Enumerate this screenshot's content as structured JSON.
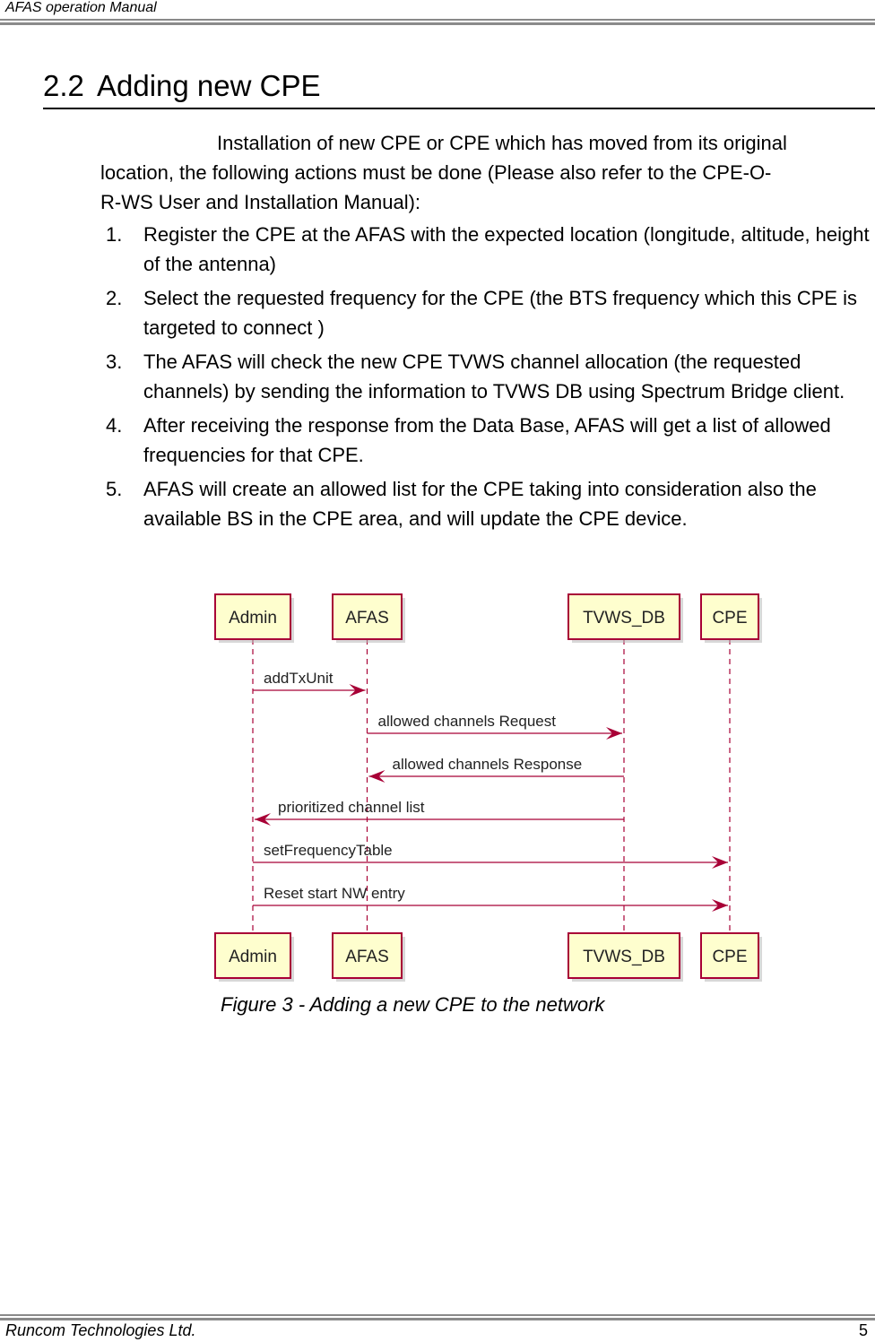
{
  "header": {
    "title": "AFAS operation Manual"
  },
  "section": {
    "number": "2.2",
    "title": "Adding new CPE"
  },
  "intro": {
    "line1": "Installation of new CPE or CPE which has moved from its original",
    "line2": "location, the following actions must be done (Please also refer to the CPE-O-",
    "line3": "R-WS User and Installation Manual):"
  },
  "steps": [
    {
      "num": "1.",
      "text": "Register the CPE at the AFAS with the expected location (longitude, altitude, height of the antenna)"
    },
    {
      "num": "2.",
      "text": "Select the requested frequency for the CPE (the BTS frequency which this CPE is targeted to connect )"
    },
    {
      "num": "3.",
      "text": "The AFAS will check the new CPE TVWS channel allocation (the requested channels) by sending the information to TVWS DB using Spectrum Bridge client."
    },
    {
      "num": "4.",
      "text": "After receiving the response from the Data Base, AFAS will get a list of allowed frequencies for that CPE."
    },
    {
      "num": "5.",
      "text": "AFAS will create an allowed list for the CPE taking into consideration also the available BS in the CPE area, and will update the CPE device."
    }
  ],
  "diagram": {
    "colors": {
      "box_fill": "#FEFECE",
      "box_border": "#A80036",
      "line": "#A80036",
      "text": "#222222"
    },
    "participants": [
      {
        "id": "admin",
        "label": "Admin"
      },
      {
        "id": "afas",
        "label": "AFAS"
      },
      {
        "id": "tvws",
        "label": "TVWS_DB"
      },
      {
        "id": "cpe",
        "label": "CPE"
      }
    ],
    "messages": [
      {
        "from": "admin",
        "to": "afas",
        "label": "addTxUnit"
      },
      {
        "from": "afas",
        "to": "tvws",
        "label": "allowed channels Request"
      },
      {
        "from": "tvws",
        "to": "afas",
        "label": "allowed channels Response"
      },
      {
        "from": "tvws",
        "to": "admin",
        "label": "prioritized channel list"
      },
      {
        "from": "admin",
        "to": "cpe",
        "label": "setFrequencyTable"
      },
      {
        "from": "admin",
        "to": "cpe",
        "label": "Reset start NW entry"
      }
    ]
  },
  "caption": "Figure 3 - Adding a new CPE to the network",
  "footer": {
    "company": "Runcom Technologies Ltd.",
    "page": "5"
  }
}
